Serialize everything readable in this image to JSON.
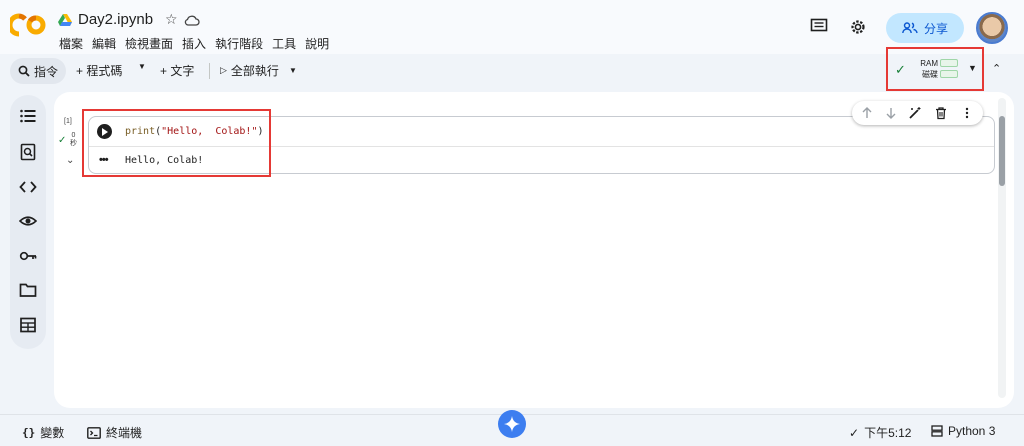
{
  "header": {
    "notebook_title": "Day2.ipynb",
    "menu": [
      "檔案",
      "編輯",
      "檢視畫面",
      "插入",
      "執行階段",
      "工具",
      "說明"
    ],
    "share_label": "分享"
  },
  "toolbar": {
    "commands_label": "指令",
    "add_code_label": "+ 程式碼",
    "add_text_label": "+ 文字",
    "run_all_label": "全部執行"
  },
  "resources": {
    "ram_label": "RAM",
    "disk_label": "磁碟",
    "status": "connected"
  },
  "cell": {
    "exec_count": "[1]",
    "exec_time": "0",
    "exec_time_unit": "秒",
    "code_fn": "print",
    "code_open": "(",
    "code_str": "\"Hello,  Colab!\"",
    "code_close": ")",
    "output": "Hello, Colab!"
  },
  "statusbar": {
    "variables_label": "變數",
    "terminal_label": "終端機",
    "time_label": "下午5:12",
    "runtime_label": "Python 3"
  },
  "colors": {
    "accent": "#0b57d0",
    "share_bg": "#c2e7ff",
    "success": "#188038",
    "highlight": "#e53935"
  }
}
